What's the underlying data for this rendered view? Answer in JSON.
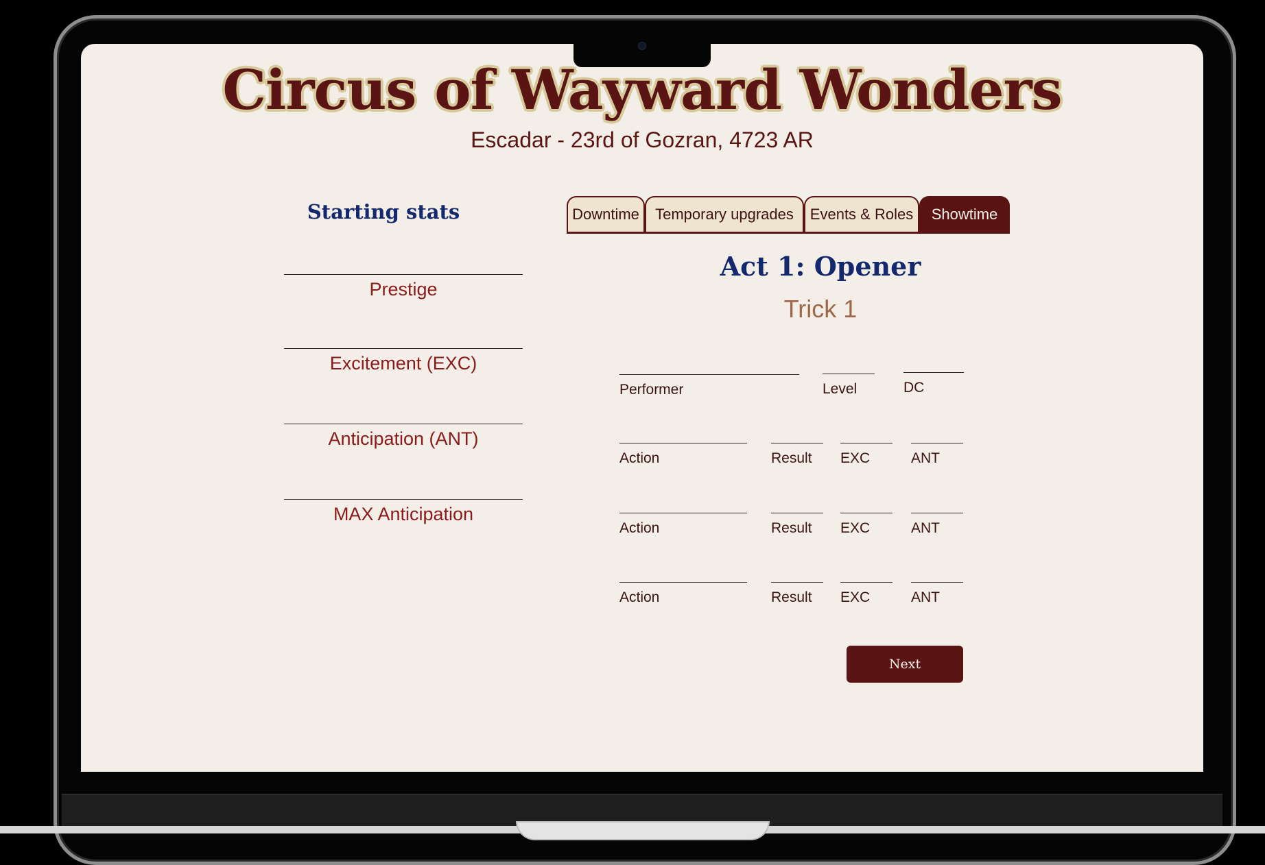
{
  "app": {
    "title": "Circus of Wayward Wonders",
    "subtitle": "Escadar - 23rd of Gozran, 4723 AR"
  },
  "sidebar": {
    "heading": "Starting stats",
    "stats": [
      {
        "label": "Prestige",
        "value": ""
      },
      {
        "label": "Excitement (EXC)",
        "value": ""
      },
      {
        "label": "Anticipation (ANT)",
        "value": ""
      },
      {
        "label": "MAX Anticipation",
        "value": ""
      }
    ]
  },
  "tabs": [
    {
      "label": "Downtime",
      "active": false
    },
    {
      "label": "Temporary upgrades",
      "active": false
    },
    {
      "label": "Events & Roles",
      "active": false
    },
    {
      "label": "Showtime",
      "active": true
    }
  ],
  "showtime": {
    "act_heading": "Act 1: Opener",
    "trick_heading": "Trick 1",
    "performer_row": {
      "performer_label": "Performer",
      "level_label": "Level",
      "dc_label": "DC"
    },
    "action_rows": [
      {
        "action_label": "Action",
        "result_label": "Result",
        "exc_label": "EXC",
        "ant_label": "ANT"
      },
      {
        "action_label": "Action",
        "result_label": "Result",
        "exc_label": "EXC",
        "ant_label": "ANT"
      },
      {
        "action_label": "Action",
        "result_label": "Result",
        "exc_label": "EXC",
        "ant_label": "ANT"
      }
    ],
    "next_label": "Next"
  },
  "colors": {
    "accent": "#5a1414",
    "heading_blue": "#14286e",
    "stat_red": "#8b1a1a",
    "trick_tan": "#a0684a",
    "background": "#f3efe8"
  }
}
